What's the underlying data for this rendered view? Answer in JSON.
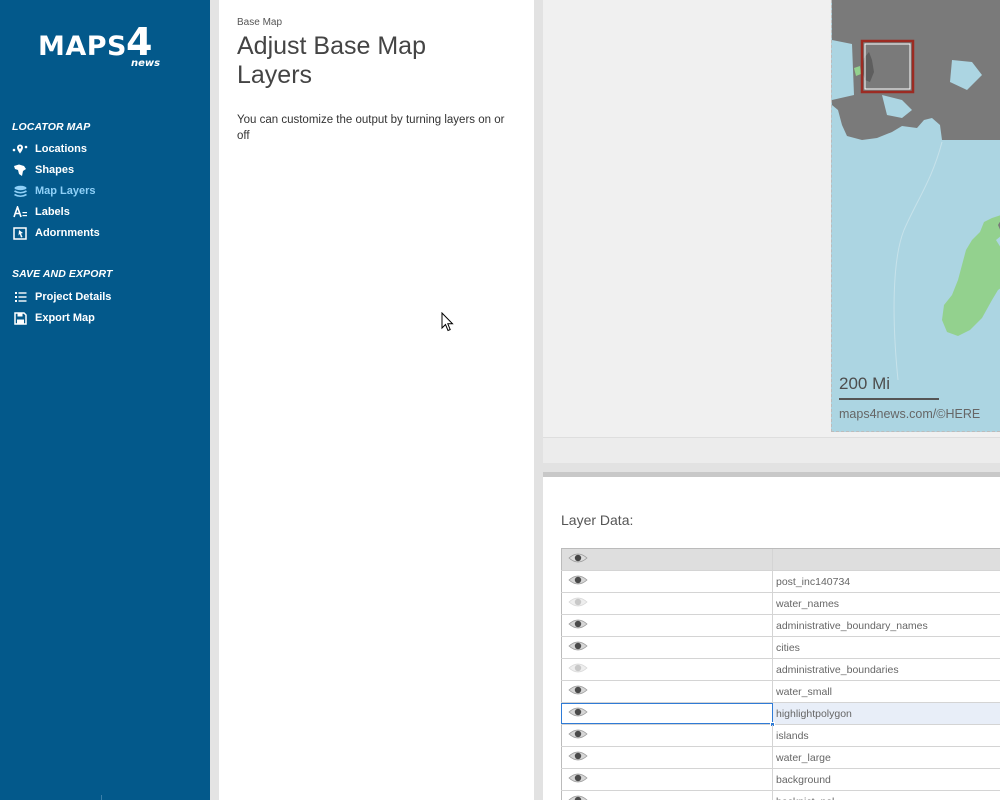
{
  "brand": {
    "name": "MAPS",
    "number": "4",
    "sub": "news"
  },
  "sidebar": {
    "sections": [
      {
        "title": "LOCATOR MAP",
        "items": [
          {
            "label": "Locations",
            "icon": "locations-icon",
            "active": false
          },
          {
            "label": "Shapes",
            "icon": "shape-icon",
            "active": false
          },
          {
            "label": "Map Layers",
            "icon": "layers-icon",
            "active": true
          },
          {
            "label": "Labels",
            "icon": "labels-icon",
            "active": false
          },
          {
            "label": "Adornments",
            "icon": "adornments-icon",
            "active": false
          }
        ]
      },
      {
        "title": "SAVE AND EXPORT",
        "items": [
          {
            "label": "Project Details",
            "icon": "list-icon",
            "active": false
          },
          {
            "label": "Export Map",
            "icon": "save-icon",
            "active": false
          }
        ]
      }
    ]
  },
  "panel": {
    "breadcrumb": "Base Map",
    "title": "Adjust Base Map Layers",
    "description": "You can customize the output by turning layers on or off"
  },
  "map": {
    "scale_label": "200 Mi",
    "attribution": "maps4news.com/©HERE",
    "colors": {
      "water": "#acd5e2",
      "land": "#7a7a7a",
      "highlight": "#93d18e",
      "inset_frame": "#9c2b22"
    }
  },
  "layer_data": {
    "title": "Layer Data:",
    "rows": [
      {
        "name": "post_inc140734",
        "visible": true
      },
      {
        "name": "water_names",
        "visible": false
      },
      {
        "name": "administrative_boundary_names",
        "visible": true
      },
      {
        "name": "cities",
        "visible": true
      },
      {
        "name": "administrative_boundaries",
        "visible": false
      },
      {
        "name": "water_small",
        "visible": true
      },
      {
        "name": "highlightpolygon",
        "visible": true,
        "selected": true
      },
      {
        "name": "islands",
        "visible": true
      },
      {
        "name": "water_large",
        "visible": true
      },
      {
        "name": "background",
        "visible": true
      },
      {
        "name": "backpict_pol",
        "visible": true
      }
    ]
  }
}
